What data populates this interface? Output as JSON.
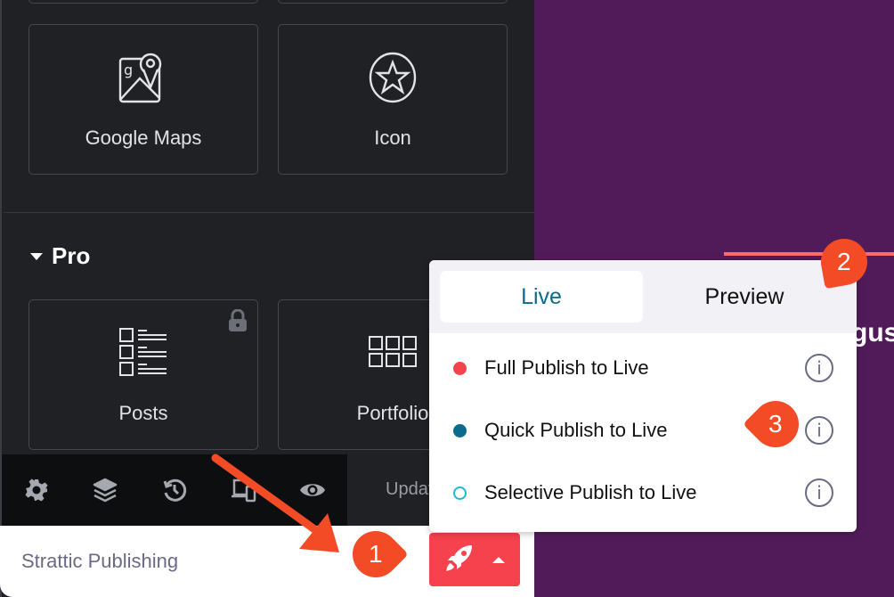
{
  "widgets": {
    "general": [
      {
        "label": "Google Maps",
        "icon": "google-maps-icon"
      },
      {
        "label": "Icon",
        "icon": "star-circle-icon"
      }
    ],
    "pro_section": {
      "title": "Pro",
      "expanded": true
    },
    "pro": [
      {
        "label": "Posts",
        "icon": "posts-list-icon",
        "locked": true
      },
      {
        "label": "Portfolio",
        "icon": "portfolio-grid-icon",
        "locked": false
      }
    ]
  },
  "toolbar": {
    "icons": [
      "gear-icon",
      "layers-icon",
      "history-icon",
      "responsive-icon",
      "eye-icon"
    ],
    "update_label": "Update"
  },
  "strattic": {
    "title": "Strattic Publishing",
    "publish_button_icon": "rocket-icon"
  },
  "dropdown": {
    "tabs": [
      {
        "label": "Live",
        "active": true
      },
      {
        "label": "Preview",
        "active": false
      }
    ],
    "options": [
      {
        "label": "Full Publish to Live",
        "dot_color": "#f5424d",
        "dot_style": "filled"
      },
      {
        "label": "Quick Publish to Live",
        "dot_color": "#0b6b8d",
        "dot_style": "filled"
      },
      {
        "label": "Selective Publish to Live",
        "dot_color": "#1fb8d3",
        "dot_style": "outline"
      }
    ],
    "info_glyph": "i"
  },
  "canvas": {
    "text_fragment": "gus"
  },
  "annotations": [
    {
      "number": "1"
    },
    {
      "number": "2"
    },
    {
      "number": "3"
    }
  ],
  "colors": {
    "accent_red": "#f5424d",
    "annotation_orange": "#f34b25",
    "canvas_purple": "#511b5a",
    "live_blue": "#0b6b8d"
  }
}
